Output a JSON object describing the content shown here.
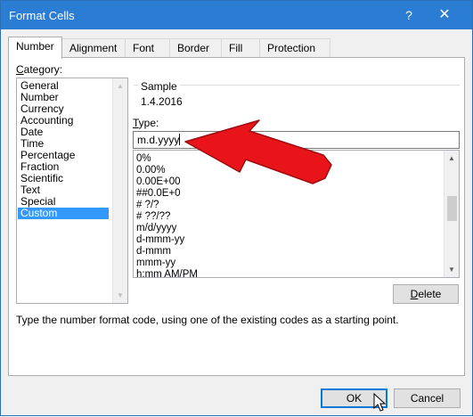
{
  "window": {
    "title": "Format Cells",
    "help_glyph": "?",
    "close_glyph": "✕"
  },
  "tabs": [
    "Number",
    "Alignment",
    "Font",
    "Border",
    "Fill",
    "Protection"
  ],
  "category": {
    "label": "Category:",
    "items": [
      "General",
      "Number",
      "Currency",
      "Accounting",
      "Date",
      "Time",
      "Percentage",
      "Fraction",
      "Scientific",
      "Text",
      "Special",
      "Custom"
    ],
    "selected": "Custom"
  },
  "sample": {
    "label": "Sample",
    "value": "1.4.2016"
  },
  "type": {
    "label": "Type:",
    "value": "m.d.yyyy"
  },
  "formats": [
    "0%",
    "0.00%",
    "0.00E+00",
    "##0.0E+0",
    "# ?/?",
    "# ??/??",
    "m/d/yyyy",
    "d-mmm-yy",
    "d-mmm",
    "mmm-yy",
    "h:mm AM/PM"
  ],
  "buttons": {
    "delete": "Delete",
    "ok": "OK",
    "cancel": "Cancel"
  },
  "hint": "Type the number format code, using one of the existing codes as a starting point.",
  "icons": {
    "scroll_up": "▲",
    "scroll_down": "▼"
  },
  "colors": {
    "titlebar": "#2b7cd3",
    "selection": "#3399ff",
    "annotation_arrow": "#e8141a"
  }
}
